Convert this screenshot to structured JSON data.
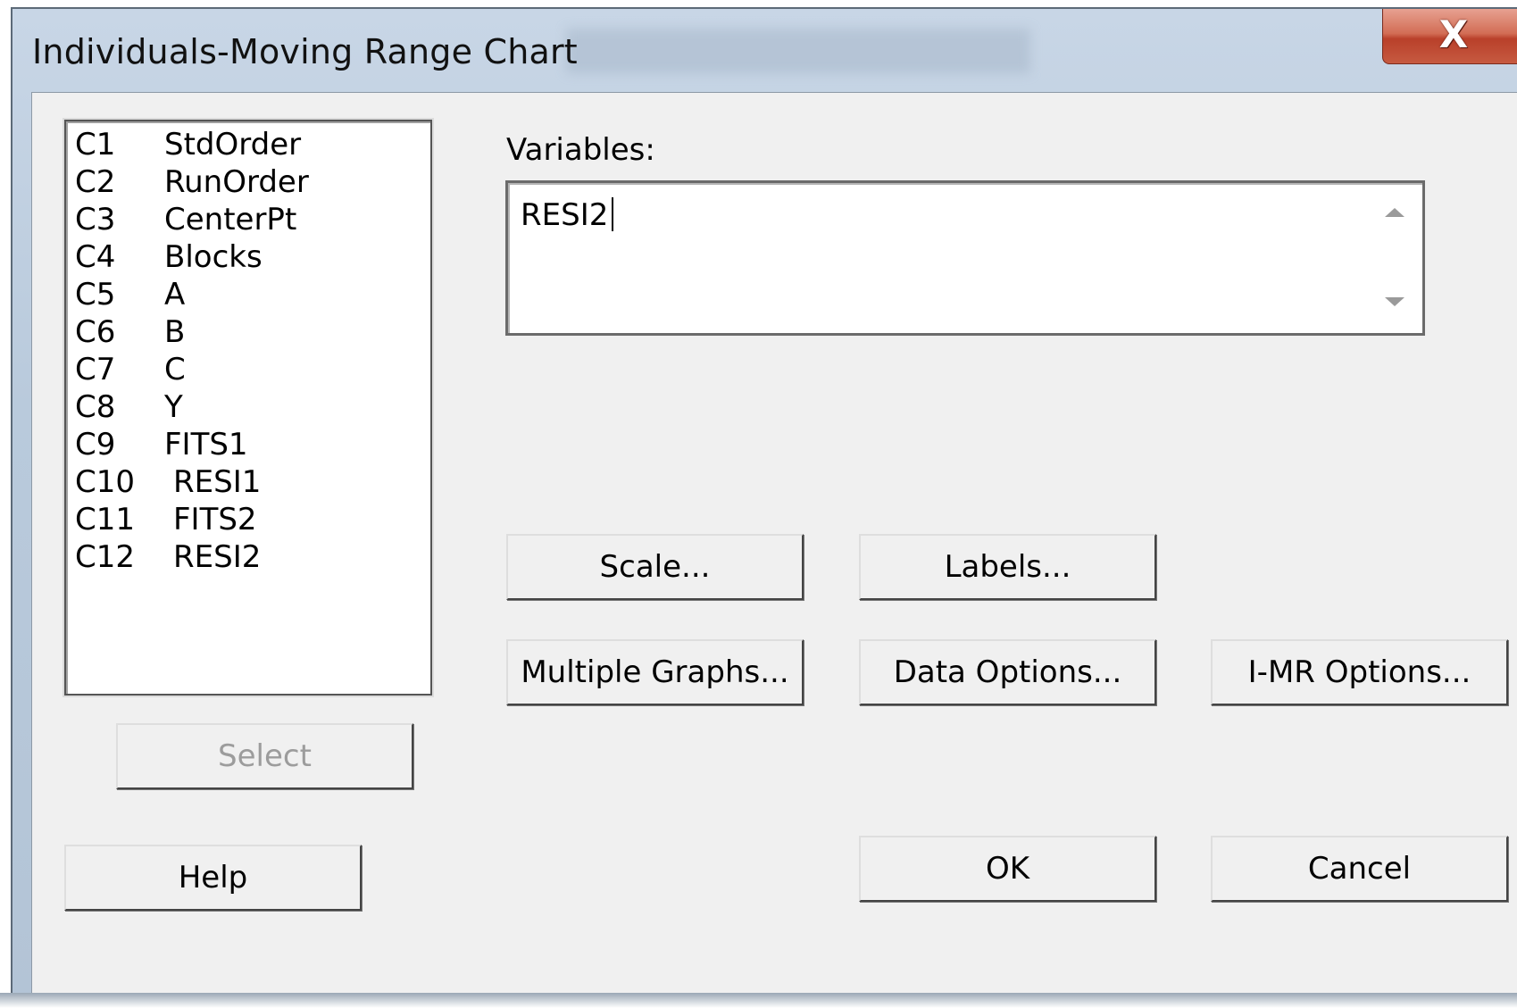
{
  "window": {
    "title": "Individuals-Moving Range Chart",
    "close_label": "X"
  },
  "columns": [
    {
      "id": "C1",
      "name": "StdOrder"
    },
    {
      "id": "C2",
      "name": "RunOrder"
    },
    {
      "id": "C3",
      "name": "CenterPt"
    },
    {
      "id": "C4",
      "name": "Blocks"
    },
    {
      "id": "C5",
      "name": "A"
    },
    {
      "id": "C6",
      "name": "B"
    },
    {
      "id": "C7",
      "name": "C"
    },
    {
      "id": "C8",
      "name": "Y"
    },
    {
      "id": "C9",
      "name": "FITS1"
    },
    {
      "id": "C10",
      "name": "RESI1"
    },
    {
      "id": "C11",
      "name": "FITS2"
    },
    {
      "id": "C12",
      "name": "RESI2"
    }
  ],
  "variables": {
    "label": "Variables:",
    "value": "RESI2"
  },
  "buttons": {
    "scale": "Scale...",
    "labels": "Labels...",
    "multiple_graphs": "Multiple Graphs...",
    "data_options": "Data Options...",
    "imr_options": "I-MR Options...",
    "select": "Select",
    "help": "Help",
    "ok": "OK",
    "cancel": "Cancel"
  }
}
